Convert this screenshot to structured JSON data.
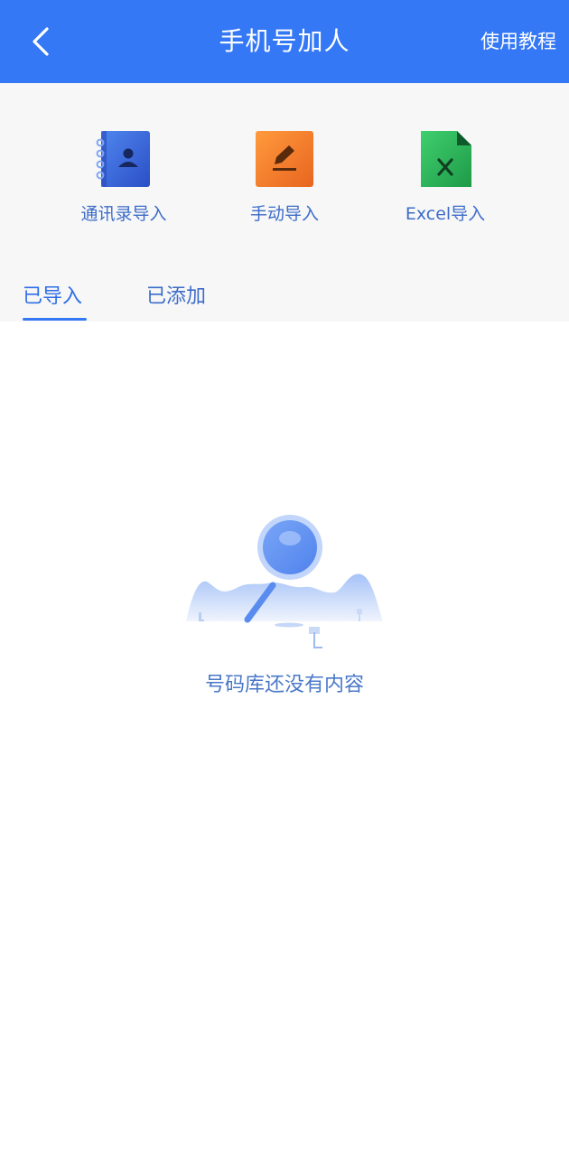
{
  "header": {
    "title": "手机号加人",
    "tutorial_label": "使用教程",
    "back_icon": "chevron-left-icon",
    "background_color": "#3478f6"
  },
  "import_options": [
    {
      "label": "通讯录导入",
      "icon": "contacts-book-icon",
      "color": "#3a63d8"
    },
    {
      "label": "手动导入",
      "icon": "edit-pen-icon",
      "color": "#f5822e"
    },
    {
      "label": "Excel导入",
      "icon": "excel-file-icon",
      "color": "#2fb55a"
    }
  ],
  "tabs": [
    {
      "label": "已导入",
      "active": true
    },
    {
      "label": "已添加",
      "active": false
    }
  ],
  "empty_state": {
    "text": "号码库还没有内容",
    "icon": "empty-search-illustration"
  }
}
